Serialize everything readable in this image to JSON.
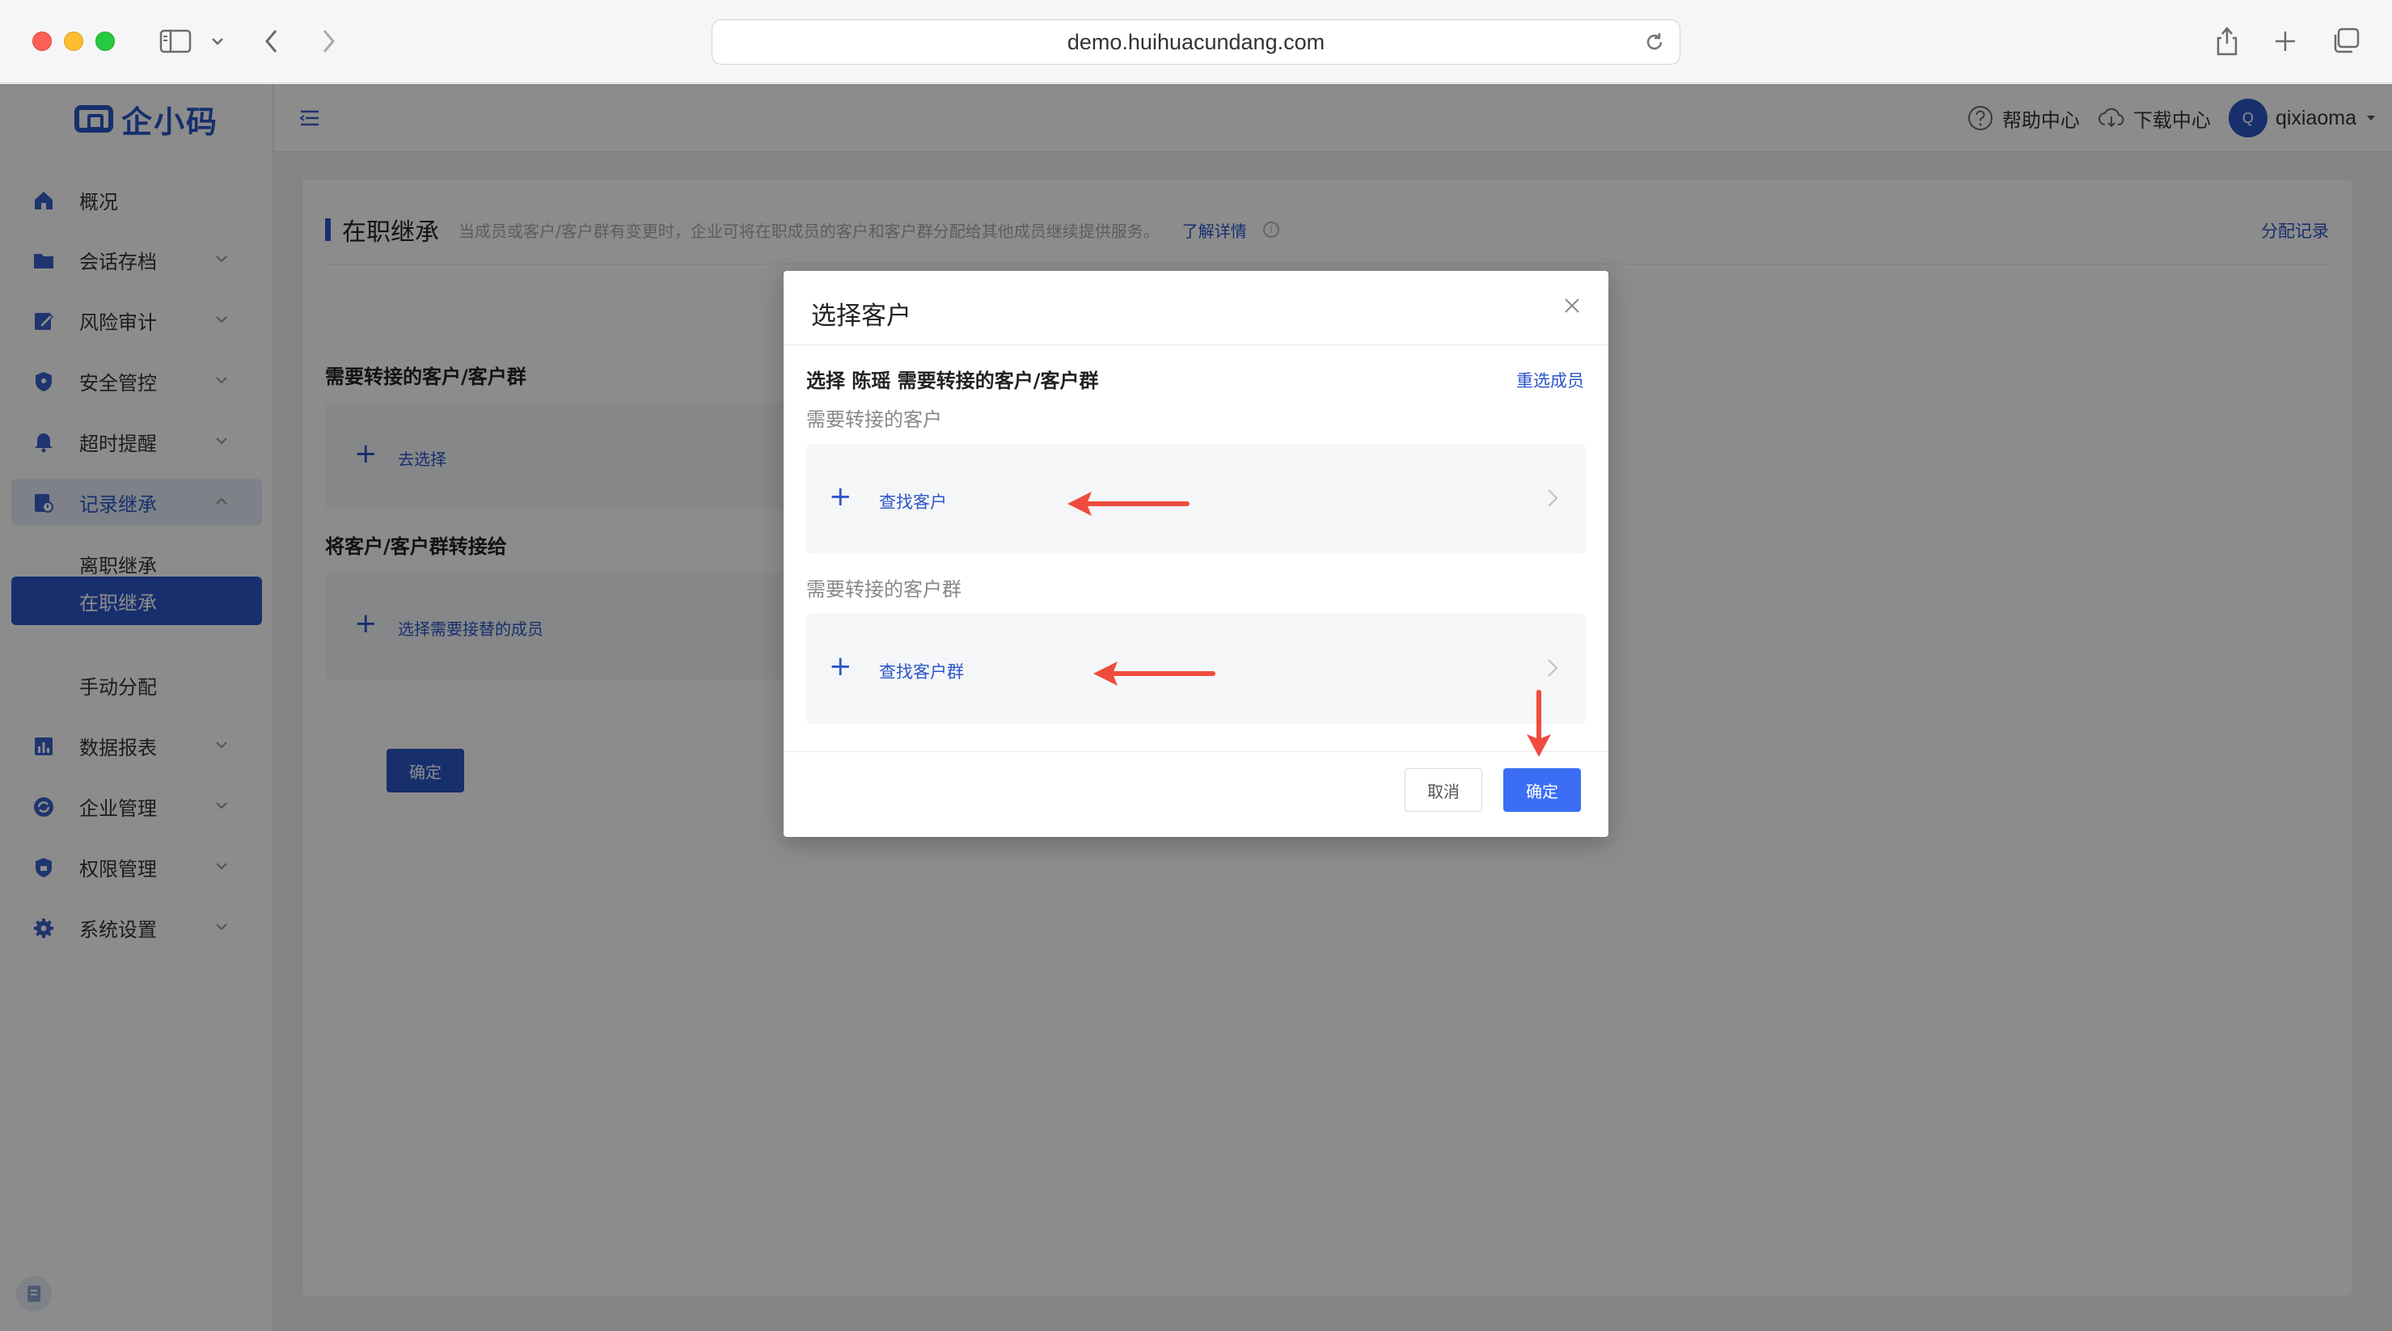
{
  "browser": {
    "url": "demo.huihuacundang.com"
  },
  "app": {
    "logo_text": "企小码",
    "brand_color": "#2b56c7",
    "accent_color": "#3b6ef5",
    "annotation_color": "#ee4c3e"
  },
  "sidebar": {
    "items": [
      {
        "label": "概况",
        "icon": "home-icon"
      },
      {
        "label": "会话存档",
        "icon": "folder-icon"
      },
      {
        "label": "风险审计",
        "icon": "edit-icon"
      },
      {
        "label": "安全管控",
        "icon": "shield-icon"
      },
      {
        "label": "超时提醒",
        "icon": "bell-icon"
      },
      {
        "label": "记录继承",
        "icon": "record-icon"
      },
      {
        "label": "数据报表",
        "icon": "bar-chart-icon"
      },
      {
        "label": "企业管理",
        "icon": "sync-icon"
      },
      {
        "label": "权限管理",
        "icon": "lock-shield-icon"
      },
      {
        "label": "系统设置",
        "icon": "gear-icon"
      }
    ],
    "sub_items": [
      {
        "label": "离职继承"
      },
      {
        "label": "在职继承"
      },
      {
        "label": "手动分配"
      }
    ]
  },
  "topbar": {
    "help": "帮助中心",
    "download": "下载中心",
    "avatar_letter": "Q",
    "user": "qixiaoma"
  },
  "page": {
    "title": "在职继承",
    "description": "当成员或客户/客户群有变更时，企业可将在职成员的客户和客户群分配给其他成员继续提供服务。",
    "learn_more": "了解详情",
    "assign_record": "分配记录",
    "section1_label": "需要转接的客户/客户群",
    "section1_action": "去选择",
    "section2_label": "将客户/客户群转接给",
    "section2_action": "选择需要接替的成员",
    "confirm": "确定"
  },
  "modal": {
    "title": "选择客户",
    "subtitle": "选择 陈瑶 需要转接的客户/客户群",
    "reselect": "重选成员",
    "customers_label": "需要转接的客户",
    "customers_action": "查找客户",
    "groups_label": "需要转接的客户群",
    "groups_action": "查找客户群",
    "cancel": "取消",
    "ok": "确定"
  }
}
